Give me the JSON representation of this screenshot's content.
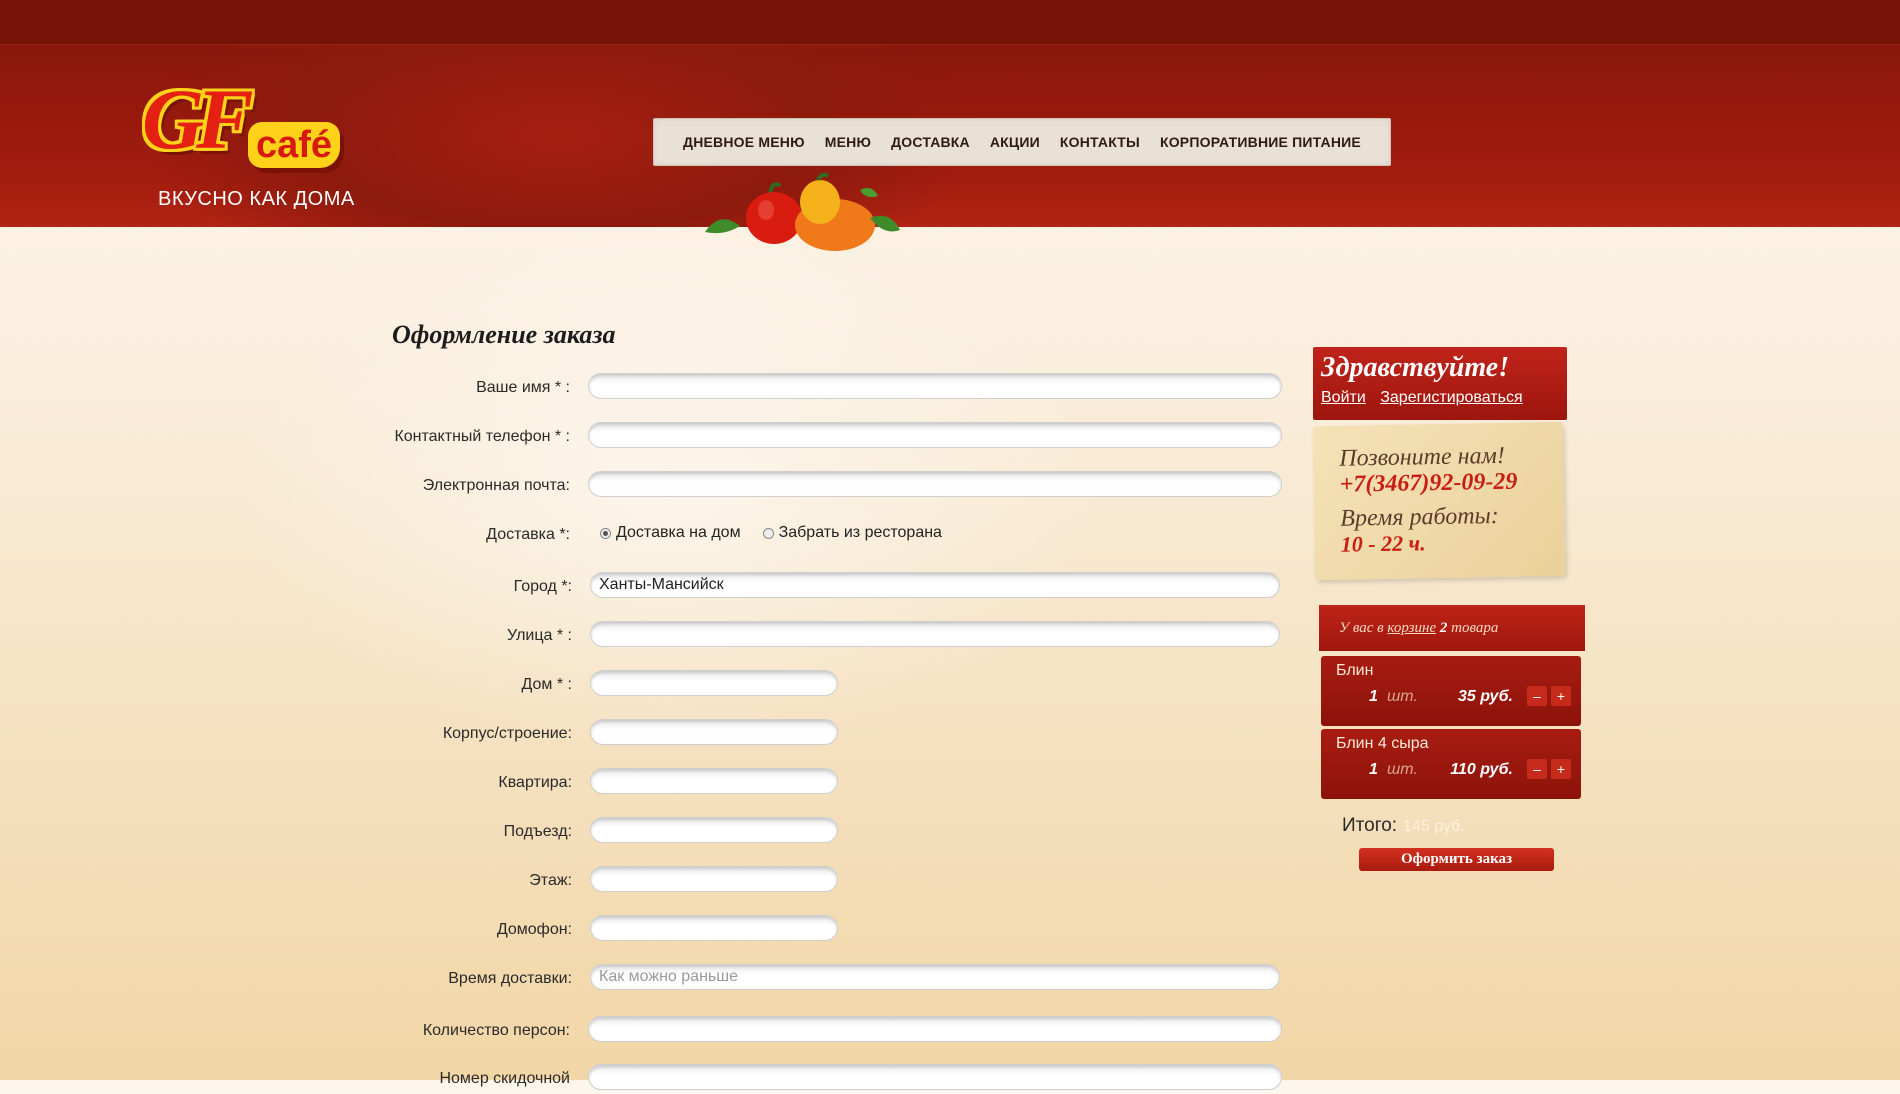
{
  "logo": {
    "brand": "GF café",
    "tagline": "ВКУСНО КАК ДОМА"
  },
  "nav": {
    "items": [
      {
        "label": "ДНЕВНОЕ МЕНЮ"
      },
      {
        "label": "МЕНЮ"
      },
      {
        "label": "ДОСТАВКА"
      },
      {
        "label": "АКЦИИ"
      },
      {
        "label": "КОНТАКТЫ"
      },
      {
        "label": "КОРПОРАТИВНИЕ ПИТАНИЕ"
      }
    ]
  },
  "form": {
    "title": "Оформление заказа",
    "fields": {
      "name": {
        "label": "Ваше имя  * :",
        "value": ""
      },
      "phone": {
        "label": "Контактный телефон  * :",
        "value": ""
      },
      "email": {
        "label": "Электронная почта:",
        "value": ""
      },
      "delivery": {
        "label": "Доставка *:",
        "options": [
          {
            "label": "Доставка на дом",
            "selected": true
          },
          {
            "label": "Забрать из ресторана",
            "selected": false
          }
        ]
      },
      "city": {
        "label": "Город *:",
        "value": "Ханты-Мансийск"
      },
      "street": {
        "label": "Улица  * :",
        "value": ""
      },
      "house": {
        "label": "Дом  * :",
        "value": ""
      },
      "building": {
        "label": "Корпус/строение:",
        "value": ""
      },
      "apartment": {
        "label": "Квартира:",
        "value": ""
      },
      "entrance": {
        "label": "Подъезд:",
        "value": ""
      },
      "floor": {
        "label": "Этаж:",
        "value": ""
      },
      "intercom": {
        "label": "Домофон:",
        "value": ""
      },
      "delivery_time": {
        "label": "Время доставки:",
        "placeholder": "Как можно раньше"
      },
      "persons": {
        "label": "Количество персон:",
        "value": ""
      },
      "discount": {
        "label": "Номер скидочной",
        "value": ""
      }
    }
  },
  "greeting": {
    "title": "Здравствуйте!",
    "login": "Войти",
    "register": "Зарегистироваться"
  },
  "contact_note": {
    "call": "Позвоните нам!",
    "phone": "+7(3467)92-09-29",
    "hours_label": "Время работы:",
    "hours": "10 - 22 ч."
  },
  "cart": {
    "prefix": "У вас в",
    "link": "корзине",
    "count": "2",
    "suffix": "товара",
    "items": [
      {
        "name": "Блин",
        "qty": "1",
        "unit": "шт.",
        "price": "35  руб.",
        "minus": "–",
        "plus": "+"
      },
      {
        "name": "Блин 4 сыра",
        "qty": "1",
        "unit": "шт.",
        "price": "110  руб.",
        "minus": "–",
        "plus": "+"
      }
    ],
    "total_label": "Итого:",
    "total_value": "145 руб.",
    "order_button": "Оформить заказ"
  },
  "colors": {
    "header": "#8a170b",
    "accent": "#c0241a",
    "nav_bg": "#e9e1d6"
  }
}
